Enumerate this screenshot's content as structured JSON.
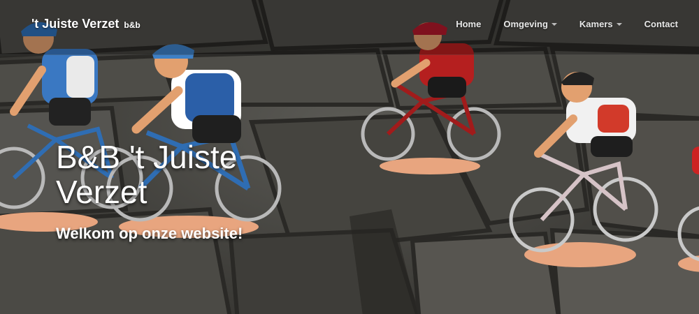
{
  "brand": {
    "name": "'t Juiste Verzet",
    "suffix": "b&b"
  },
  "nav": {
    "items": [
      {
        "label": "Home"
      },
      {
        "label": "Omgeving"
      },
      {
        "label": "Kamers"
      },
      {
        "label": "Contact"
      }
    ]
  },
  "hero": {
    "title": "B&B 't Juiste Verzet",
    "subtitle": "Welkom op onze website!",
    "image_description": "toy cyclist figurines on cobblestones"
  },
  "colors": {
    "text": "#ffffff",
    "nav_text": "#e8e8e8",
    "navbar_overlay": "rgba(0,0,0,0.28)",
    "figurine_base": "#e8a57f"
  }
}
